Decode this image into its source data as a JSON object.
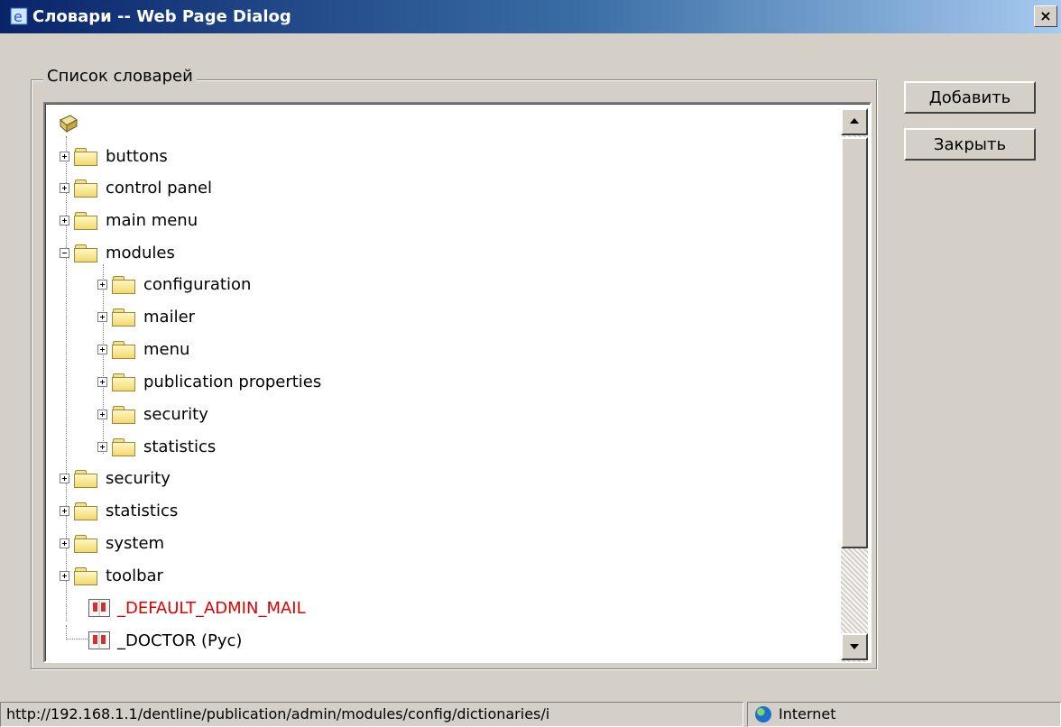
{
  "window": {
    "title": "Словари -- Web Page Dialog",
    "close_label": "×"
  },
  "group": {
    "legend": "Список словарей"
  },
  "buttons": {
    "add": "Добавить",
    "close": "Закрыть"
  },
  "tree": {
    "items": [
      {
        "label": "buttons"
      },
      {
        "label": "control panel"
      },
      {
        "label": "main menu"
      },
      {
        "label": "modules"
      },
      {
        "label": "configuration"
      },
      {
        "label": "mailer"
      },
      {
        "label": "menu"
      },
      {
        "label": "publication properties"
      },
      {
        "label": "security"
      },
      {
        "label": "statistics"
      },
      {
        "label": "security"
      },
      {
        "label": "statistics"
      },
      {
        "label": "system"
      },
      {
        "label": "toolbar"
      },
      {
        "label": "_DEFAULT_ADMIN_MAIL"
      },
      {
        "label": "_DOCTOR (Рус)"
      }
    ]
  },
  "status": {
    "url": "http://192.168.1.1/dentline/publication/admin/modules/config/dictionaries/i",
    "zone": "Internet"
  }
}
